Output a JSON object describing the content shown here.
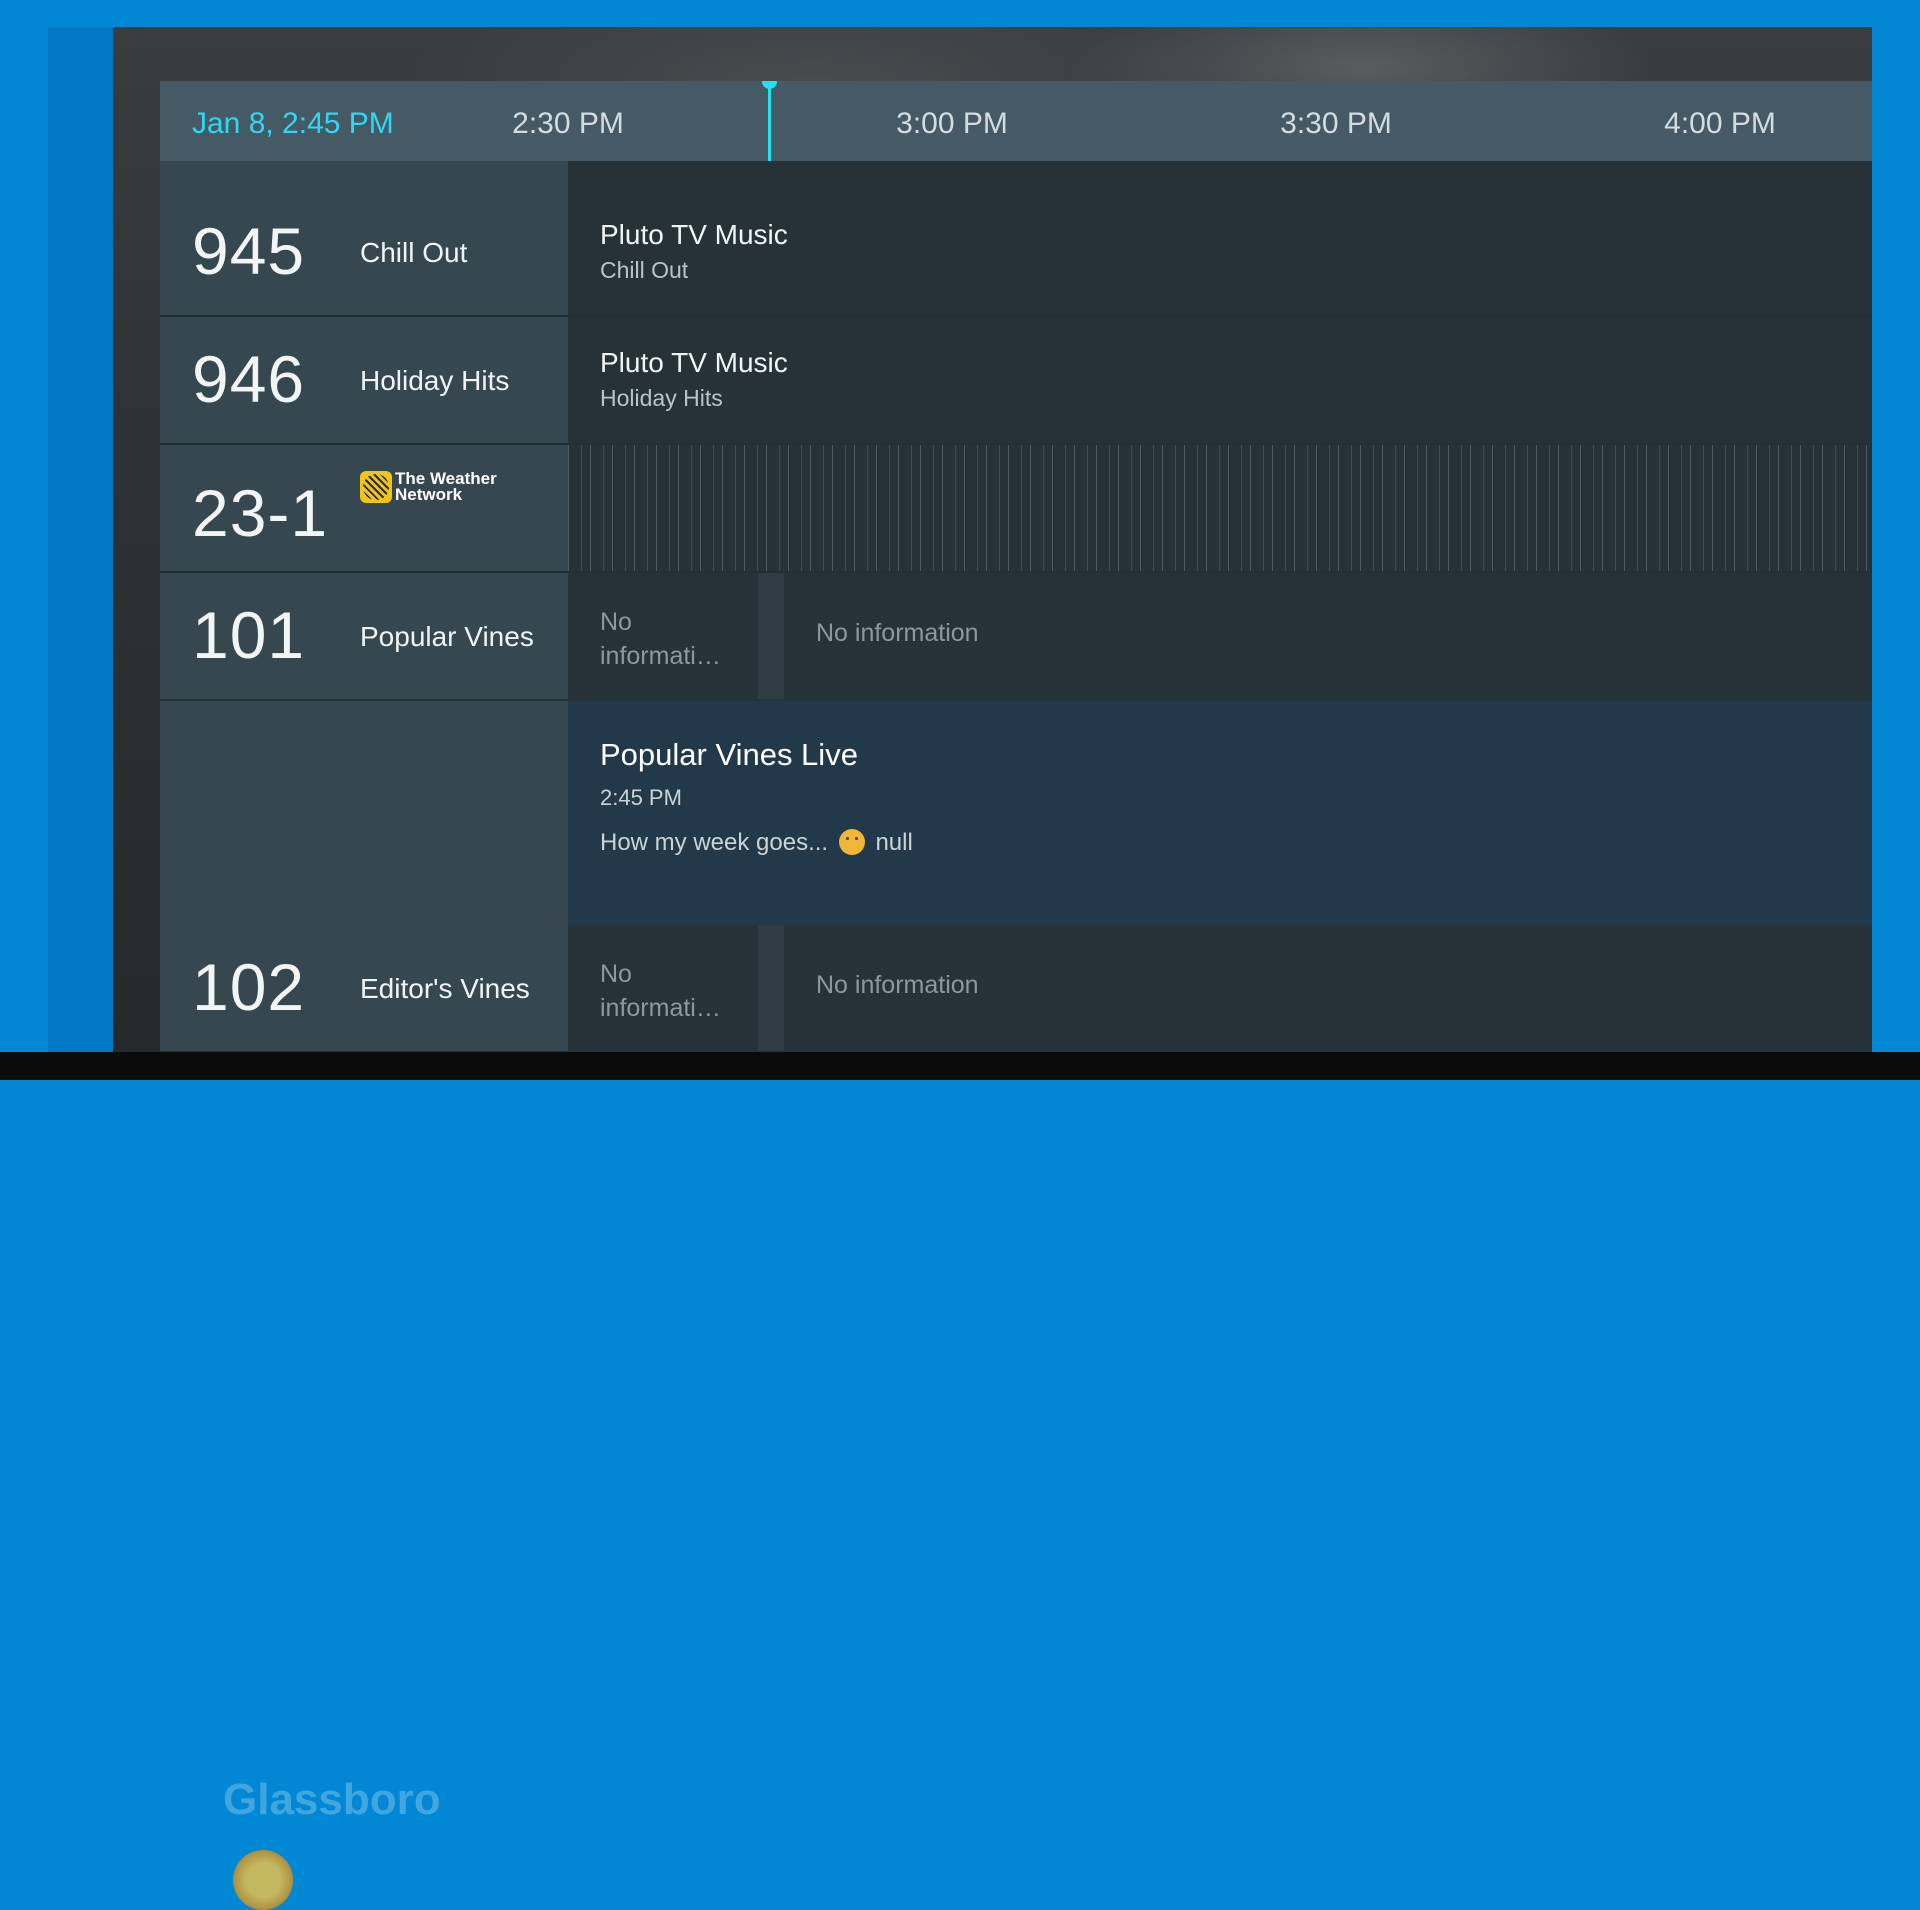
{
  "header": {
    "current_datetime": "Jan 8, 2:45 PM",
    "time_ticks": [
      "2:30 PM",
      "3:00 PM",
      "3:30 PM",
      "4:00 PM"
    ]
  },
  "channels": [
    {
      "number": "945",
      "name": "Chill Out",
      "program_title": "Pluto TV Music",
      "program_subtitle": "Chill Out"
    },
    {
      "number": "946",
      "name": "Holiday Hits",
      "program_title": "Pluto TV Music",
      "program_subtitle": "Holiday Hits"
    },
    {
      "number": "23-1",
      "logo_text": "The Weather Network",
      "logo_icon": "weather-network-logo"
    },
    {
      "number": "101",
      "name": "Popular Vines",
      "programs": [
        "No informati…",
        "No information"
      ]
    },
    {
      "number": "102",
      "name": "Editor's Vines",
      "programs": [
        "No informati…",
        "No information"
      ]
    }
  ],
  "detail": {
    "title": "Popular Vines Live",
    "time": "2:45 PM",
    "description": "How my week goes...",
    "description_emoji": "thinking-face-icon",
    "description_suffix": "null"
  },
  "background": {
    "city": "Glassboro"
  },
  "colors": {
    "accent": "#22e1f0",
    "timebar": "#455a64",
    "channel_column": "#37474f",
    "grid": "#263238",
    "detail_panel": "#22394a",
    "frame": "#0287d4"
  }
}
